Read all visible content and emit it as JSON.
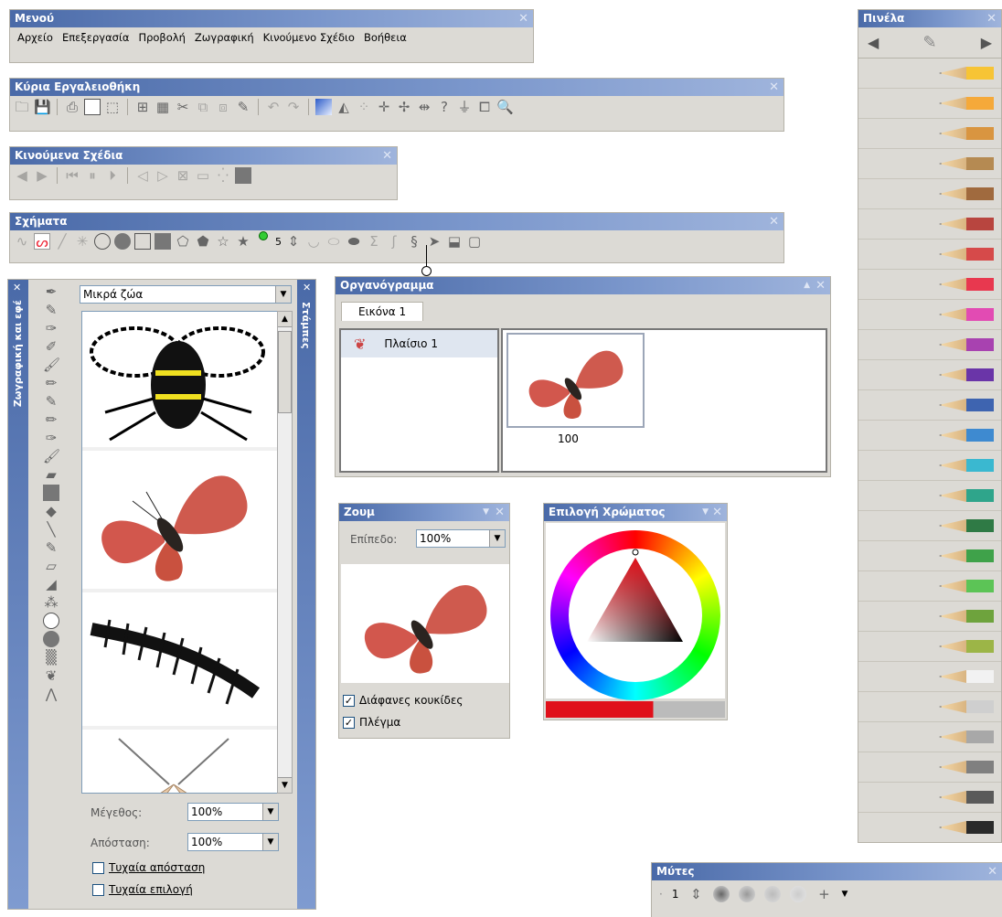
{
  "menu": {
    "title": "Μενού",
    "items": [
      "Αρχείο",
      "Επεξεργασία",
      "Προβολή",
      "Ζωγραφική",
      "Κινούμενο Σχέδιο",
      "Βοήθεια"
    ]
  },
  "main_toolbar": {
    "title": "Κύρια Εργαλειοθήκη"
  },
  "animation_toolbar": {
    "title": "Κινούμενα Σχέδια"
  },
  "shapes_toolbar": {
    "title": "Σχήματα",
    "points_value": "5"
  },
  "paint_effects": {
    "title": "Ζωγραφική και εφέ",
    "category": "Μικρά ζώα",
    "items": [
      "bee",
      "butterfly",
      "centipede",
      "moth"
    ],
    "size_label": "Μέγεθος:",
    "size_value": "100%",
    "spacing_label": "Απόσταση:",
    "spacing_value": "100%",
    "random_spacing": "Τυχαία απόσταση",
    "random_selection": "Τυχαία επιλογή"
  },
  "stamps_tab": {
    "title": "Στάμπες"
  },
  "storyboard": {
    "title": "Οργανόγραμμα",
    "tab": "Εικόνα 1",
    "frame_label": "Πλαίσιο 1",
    "frame_duration": "100"
  },
  "zoom": {
    "title": "Ζουμ",
    "level_label": "Επίπεδο:",
    "level_value": "100%",
    "transparent_dots": "Διάφανες κουκίδες",
    "grid": "Πλέγμα"
  },
  "color_picker": {
    "title": "Επιλογή Χρώματος"
  },
  "palette": {
    "title": "Πινέλα",
    "pencil_colors": [
      "#f7c435",
      "#f5a93a",
      "#d99540",
      "#b58a52",
      "#a06a3e",
      "#b8453f",
      "#d64a4a",
      "#e8384f",
      "#e24bb3",
      "#a842b0",
      "#6a35a8",
      "#3e64b0",
      "#3e8ad0",
      "#3ab8d0",
      "#2fa58b",
      "#2f7a45",
      "#3fa24a",
      "#5cc456",
      "#6ea33d",
      "#9cb547",
      "#f2f2f2",
      "#cfcfcf",
      "#a8a8a8",
      "#808080",
      "#5a5a5a",
      "#2a2a2a"
    ]
  },
  "tips": {
    "title": "Μύτες",
    "value": "1"
  }
}
